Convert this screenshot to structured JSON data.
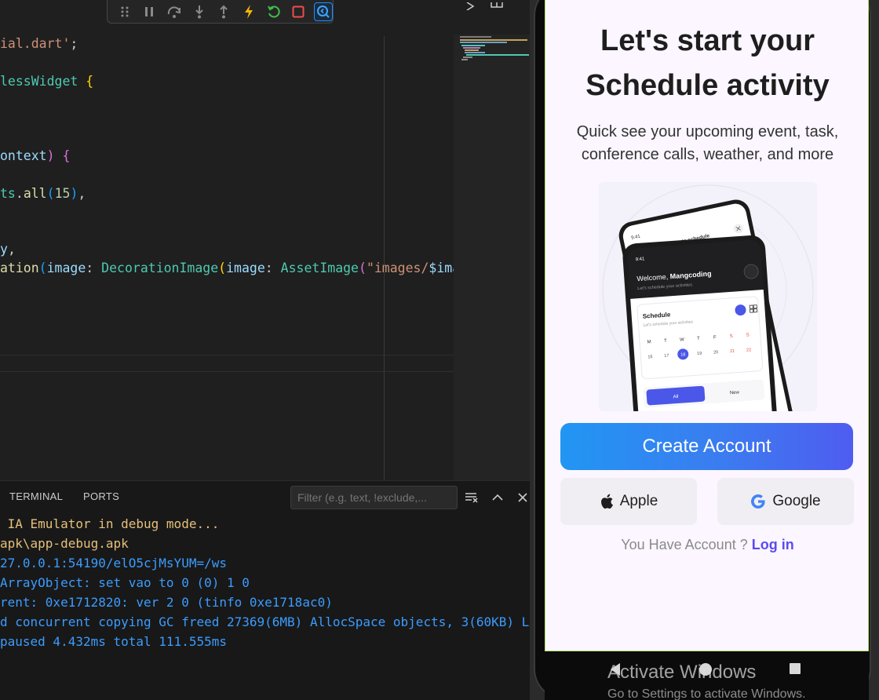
{
  "editor": {
    "lines": [
      [
        [
          "t-str",
          "ial.dart'"
        ],
        [
          "t-plain",
          ";"
        ]
      ],
      [
        [
          "t-cls",
          "lessWidget"
        ],
        [
          "t-plain",
          " "
        ],
        [
          "t-br1",
          "{"
        ]
      ],
      [
        [
          "t-var",
          "ontext"
        ],
        [
          "t-br2",
          ")"
        ],
        [
          "t-plain",
          " "
        ],
        [
          "t-br2",
          "{"
        ]
      ],
      [
        [
          "t-cls",
          "ts"
        ],
        [
          "t-plain",
          "."
        ],
        [
          "t-fn",
          "all"
        ],
        [
          "t-br3",
          "("
        ],
        [
          "t-num",
          "15"
        ],
        [
          "t-br3",
          ")"
        ],
        [
          "t-plain",
          ","
        ]
      ],
      [
        [
          "t-var",
          "y"
        ],
        [
          "t-plain",
          ","
        ]
      ],
      [
        [
          "t-fn",
          "ation"
        ],
        [
          "t-br3",
          "("
        ],
        [
          "t-var",
          "image"
        ],
        [
          "t-plain",
          ": "
        ],
        [
          "t-cls",
          "DecorationImage"
        ],
        [
          "t-br1",
          "("
        ],
        [
          "t-var",
          "image"
        ],
        [
          "t-plain",
          ": "
        ],
        [
          "t-cls",
          "AssetImage"
        ],
        [
          "t-br2",
          "("
        ],
        [
          "t-str",
          "\"images/"
        ],
        [
          "t-var",
          "$image"
        ]
      ]
    ],
    "debug_toolbar": [
      "drag-handle-icon",
      "pause-icon",
      "step-over-icon",
      "step-into-icon",
      "step-out-icon",
      "hot-reload-icon",
      "restart-icon",
      "stop-icon",
      "devtools-icon"
    ]
  },
  "panel": {
    "tabs": [
      "TERMINAL",
      "PORTS"
    ],
    "filter_placeholder": "Filter (e.g. text, !exclude,...",
    "terminal_lines": [
      {
        "color": "c-yellow",
        "text": " IA Emulator in debug mode..."
      },
      {
        "color": "c-yellow",
        "text": "apk\\app-debug.apk"
      },
      {
        "color": "c-blue",
        "text": "27.0.0.1:54190/elO5cjMsYUM=/ws"
      },
      {
        "color": "c-blue",
        "text": "ArrayObject: set vao to 0 (0) 1 0"
      },
      {
        "color": "c-blue",
        "text": "rent: 0xe1712820: ver 2 0 (tinfo 0xe1718ac0)"
      },
      {
        "color": "c-blue",
        "text": "d concurrent copying GC freed 27369(6MB) AllocSpace objects, 3(60KB) L"
      },
      {
        "color": "c-blue",
        "text": "paused 4.432ms total 111.555ms"
      }
    ]
  },
  "app": {
    "title_line1": "Let's start your",
    "title_line2": "Schedule activity",
    "subtitle_line1": "Quick see your upcoming event, task,",
    "subtitle_line2": "conference calls, weather, and more",
    "illustration": {
      "back_time": "9:41",
      "back_title": "Create schedule",
      "front_time": "9:41",
      "welcome_prefix": "Welcome, ",
      "welcome_name": "Mangcoding",
      "welcome_sub": "Let's schedule your activities",
      "schedule_title": "Schedule",
      "schedule_sub": "Let's schedule your activities",
      "days": [
        "M",
        "T",
        "W",
        "T",
        "F",
        "S",
        "S"
      ],
      "dates": [
        "16",
        "17",
        "18",
        "19",
        "20",
        "21",
        "22"
      ],
      "tab_all": "All",
      "tab_new": "New"
    },
    "create_account": "Create Account",
    "apple_label": "Apple",
    "google_label": "Google",
    "have_account": "You Have Account ? ",
    "login_label": "Log in",
    "colors": {
      "accent": "#5b4bf0",
      "gradient_start": "#2196f3",
      "gradient_end": "#4f5cf0"
    }
  },
  "watermark": {
    "line1": "Activate Windows",
    "line2": "Go to Settings to activate Windows."
  }
}
